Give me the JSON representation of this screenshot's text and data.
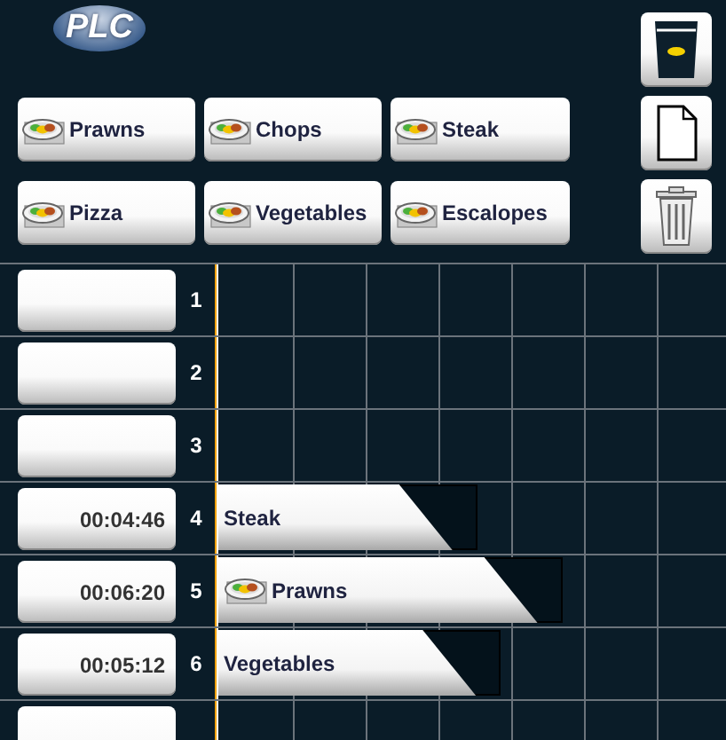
{
  "logo": "PLC",
  "recipes": [
    {
      "label": "Prawns"
    },
    {
      "label": "Chops"
    },
    {
      "label": "Steak"
    },
    {
      "label": "Pizza"
    },
    {
      "label": "Vegetables"
    },
    {
      "label": "Escalopes"
    }
  ],
  "side_buttons": [
    {
      "kind": "cup"
    },
    {
      "kind": "document"
    },
    {
      "kind": "trash"
    }
  ],
  "rows": [
    {
      "number": "1",
      "time": "",
      "bar": null
    },
    {
      "number": "2",
      "time": "",
      "bar": null
    },
    {
      "number": "3",
      "time": "",
      "bar": null
    },
    {
      "number": "4",
      "time": "00:04:46",
      "bar": {
        "label": "Steak",
        "has_icon": false
      }
    },
    {
      "number": "5",
      "time": "00:06:20",
      "bar": {
        "label": "Prawns",
        "has_icon": true
      }
    },
    {
      "number": "6",
      "time": "00:05:12",
      "bar": {
        "label": "Vegetables",
        "has_icon": false
      }
    },
    {
      "time": "",
      "bar": null
    }
  ]
}
